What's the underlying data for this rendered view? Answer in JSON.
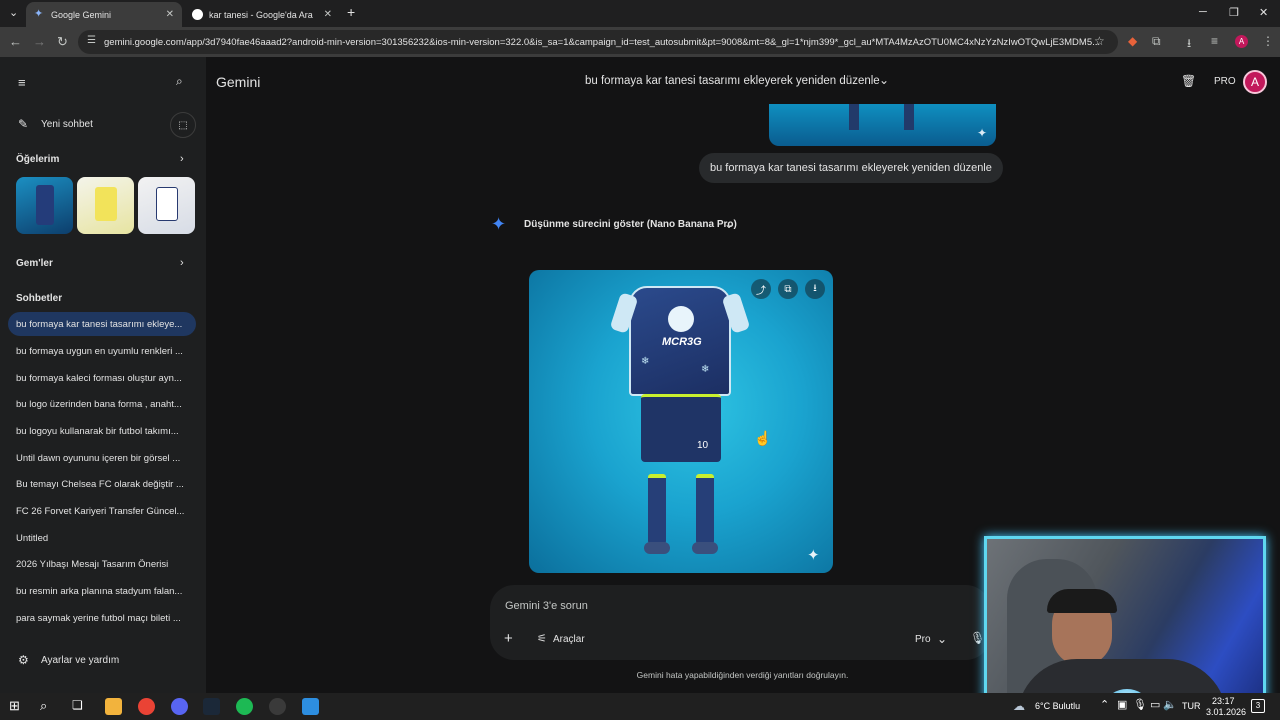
{
  "browser": {
    "tabs": [
      {
        "title": "Google Gemini",
        "active": true
      },
      {
        "title": "kar tanesi - Google'da Ara",
        "active": false
      }
    ],
    "new_tab": "+",
    "url": "gemini.google.com/app/3d7940fae46aaad2?android-min-version=301356232&ios-min-version=322.0&is_sa=1&campaign_id=test_autosubmit&pt=9008&mt=8&_gl=1*njm399*_gcl_au*MTA4MzAzOTU0MC4xNzYzNzIwOTQwLjE3MDM5..."
  },
  "sidebar": {
    "new_chat": "Yeni sohbet",
    "items_title": "Öğelerim",
    "gems_title": "Gem'ler",
    "chats_title": "Sohbetler",
    "chats": [
      "bu formaya kar tanesi tasarımı ekleye...",
      "bu formaya uygun en uyumlu renkleri ...",
      "bu formaya kaleci forması oluştur ayn...",
      "bu logo üzerinden bana forma , anaht...",
      "bu logoyu kullanarak bir futbol takımı...",
      "Until dawn oyununu içeren bir görsel ...",
      "Bu temayı Chelsea FC olarak değiştir ...",
      "FC 26 Forvet Kariyeri Transfer Güncel...",
      "Untitled",
      "2026 Yılbaşı Mesajı Tasarım Önerisi",
      "bu resmin arka planına stadyum falan...",
      "para saymak yerine futbol maçı bileti ..."
    ],
    "settings": "Ayarlar ve yardım"
  },
  "header": {
    "app_title": "Gemini",
    "conversation_title": "bu formaya kar tanesi tasarımı ekleyerek yeniden düzenle",
    "pro_badge": "PRO",
    "avatar_letter": "A"
  },
  "conversation": {
    "user_message": "bu formaya kar tanesi tasarımı ekleyerek yeniden düzenle",
    "thinking_toggle": "Düşünme sürecini göster (Nano Banana Pro)",
    "image_jersey_text": "MCR3G",
    "image_number": "10"
  },
  "input": {
    "placeholder": "Gemini 3'e sorun",
    "tools_label": "Araçlar",
    "model_label": "Pro"
  },
  "disclaimer": "Gemini hata yapabildiğinden verdiği yanıtları doğrulayın.",
  "taskbar": {
    "weather": "6°C  Bulutlu",
    "language": "TUR",
    "time": "23:17",
    "date": "3.01.2026",
    "notifications": "3"
  },
  "colors": {
    "page_bg": "#131314",
    "sidebar_bg": "#1e1f20",
    "active_chat": "#1f3760",
    "accent_blue": "#4285f4"
  }
}
